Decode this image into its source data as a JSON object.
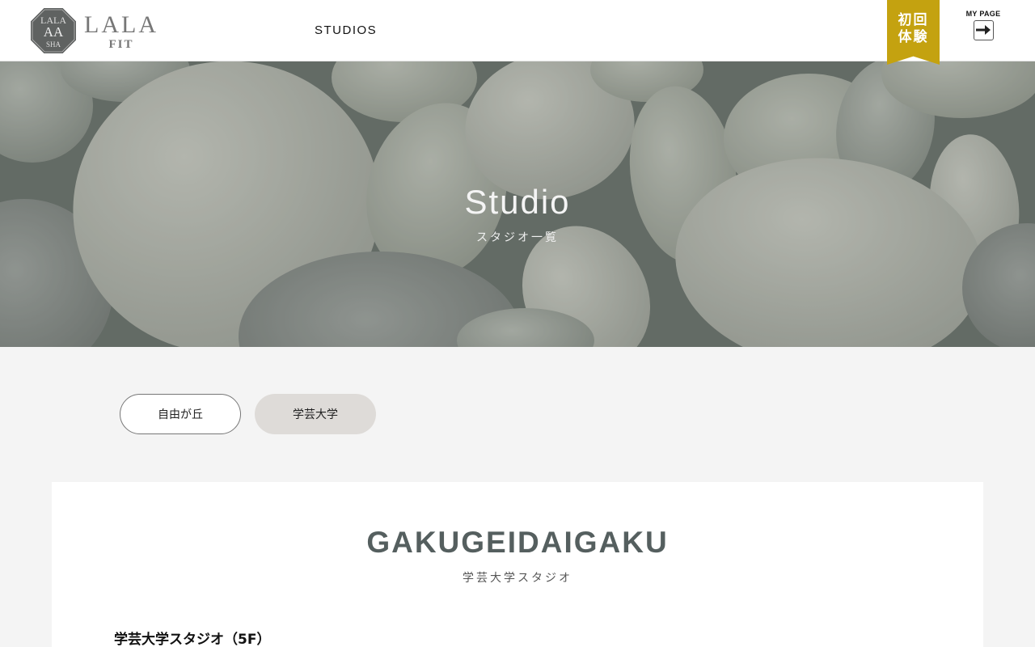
{
  "header": {
    "logo": {
      "badge_text": [
        "LALA",
        "AA",
        "SHA"
      ],
      "word": "LALA",
      "sub": "FIT"
    },
    "nav": {
      "studios": "STUDIOS"
    },
    "trial": {
      "line1": "初回",
      "line2": "体験",
      "color": "#c4a210"
    },
    "mypage": {
      "label": "MY PAGE",
      "icon": "login-arrow-icon"
    }
  },
  "hero": {
    "title": "Studio",
    "subtitle": "スタジオ一覧"
  },
  "studio_tabs": [
    {
      "label": "自由が丘",
      "selected": false
    },
    {
      "label": "学芸大学",
      "selected": true
    }
  ],
  "studio_card": {
    "title": "GAKUGEIDAIGAKU",
    "subtitle": "学芸大学スタジオ",
    "heading": "学芸大学スタジオ（5F）"
  }
}
